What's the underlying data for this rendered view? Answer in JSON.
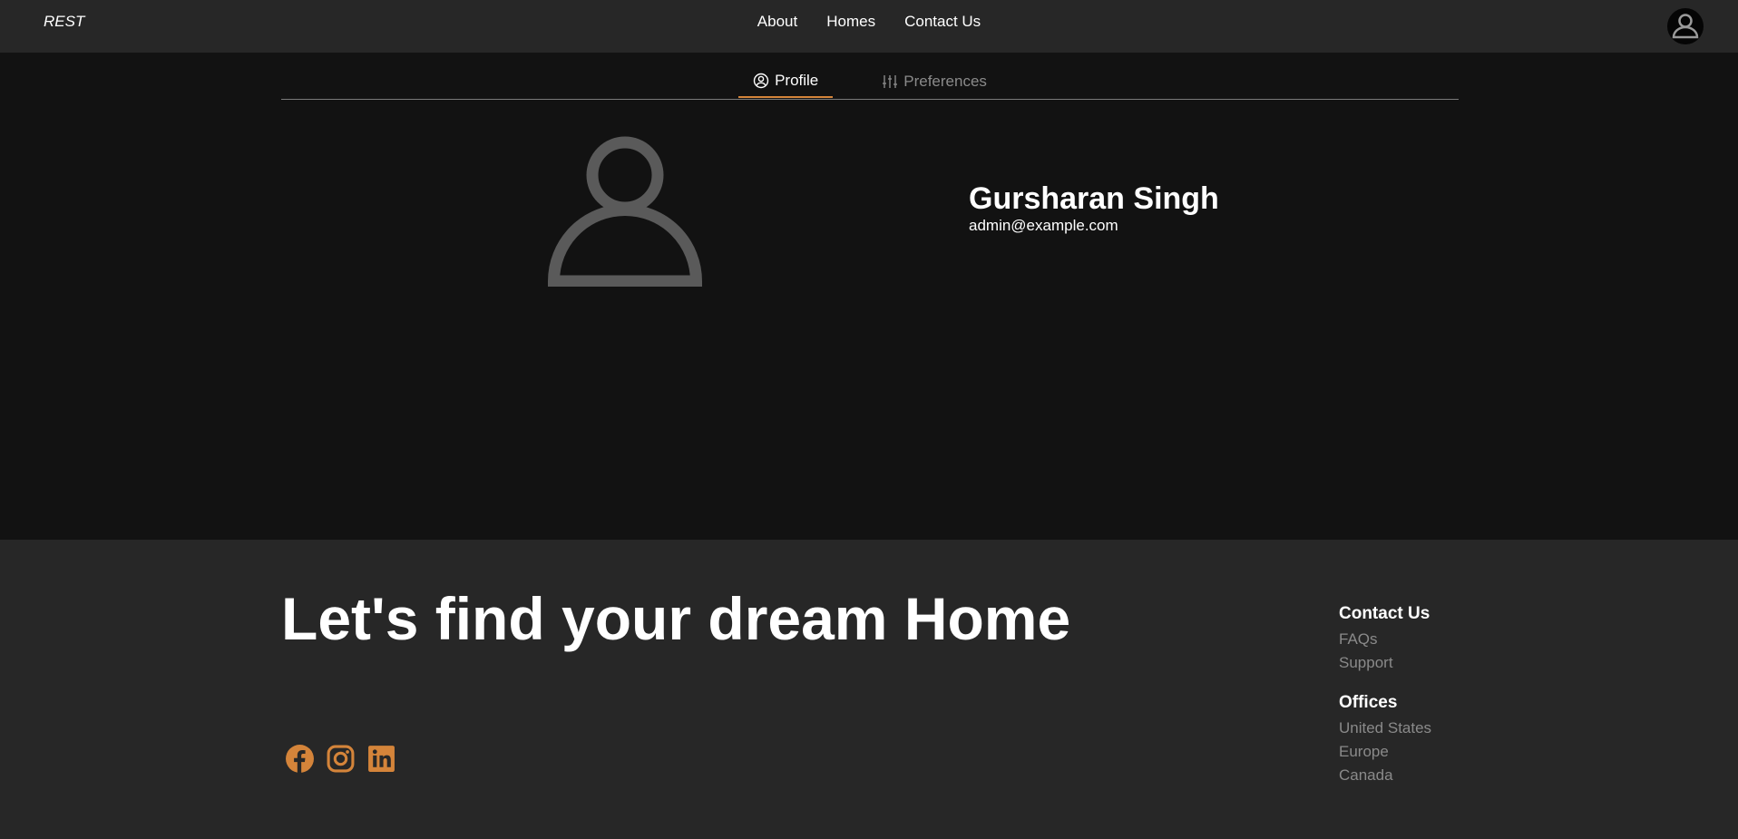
{
  "header": {
    "brand": "REST",
    "nav": [
      "About",
      "Homes",
      "Contact Us"
    ],
    "avatar_icon": "user-circle-icon"
  },
  "tabs": [
    {
      "label": "Profile",
      "icon": "user-circle-icon",
      "active": true
    },
    {
      "label": "Preferences",
      "icon": "sliders-icon",
      "active": false
    }
  ],
  "profile": {
    "name": "Gursharan Singh",
    "email": "admin@example.com",
    "avatar_icon": "user-icon"
  },
  "footer": {
    "heading": "Let's find your dream Home",
    "socials": [
      "facebook-icon",
      "instagram-icon",
      "linkedin-icon"
    ],
    "contact": {
      "title": "Contact Us",
      "links": [
        "FAQs",
        "Support"
      ]
    },
    "offices": {
      "title": "Offices",
      "links": [
        "United States",
        "Europe",
        "Canada"
      ]
    }
  },
  "colors": {
    "accent": "#d4843a",
    "header_bg": "#272727",
    "page_bg": "#121212",
    "muted_text": "#8a8a8a"
  }
}
